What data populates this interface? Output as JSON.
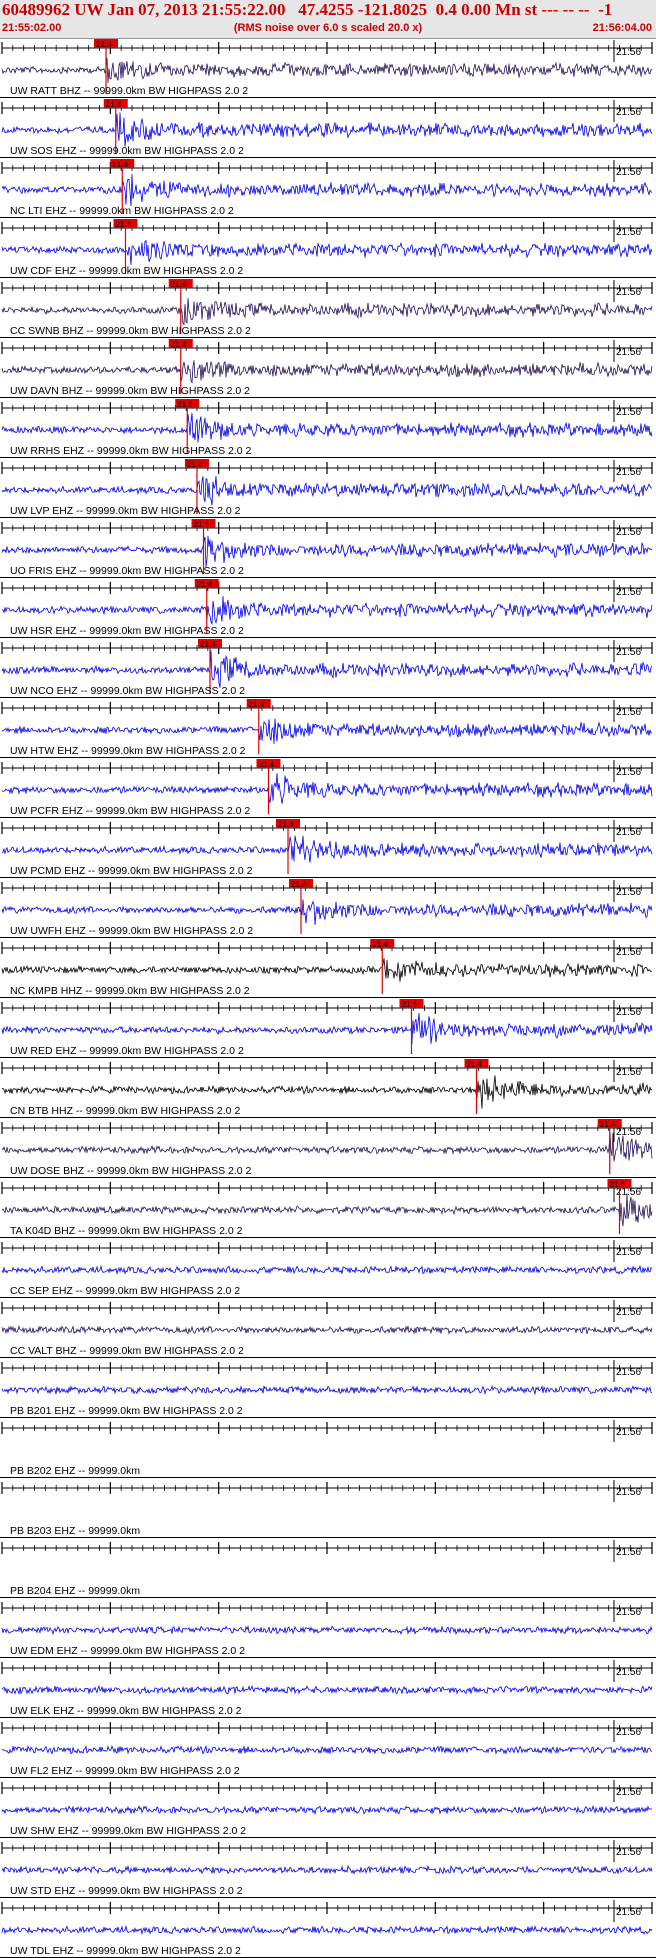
{
  "header": {
    "title": "60489962 UW Jan 07, 2013 21:55:22.00   47.4255 -121.8025  0.4 0.00 Mn st --- -- --  -1",
    "start_time": "21:55:02.00",
    "subtitle": "(RMS noise over 6.0 s scaled 20.0 x)",
    "end_time": "21:56:04.00"
  },
  "colors": {
    "background": "#ffffff",
    "title_red": "#cc0000",
    "pick_red": "#e00000",
    "trace_blue": "#0000ee",
    "trace_navy": "#26125a",
    "trace_black": "#000000",
    "axis": "#000000"
  },
  "minute_label": "21:56",
  "pick_label": "21.4",
  "traces": [
    {
      "label": "UW RATT BHZ -- 99999.0km BW  HIGHPASS  2.0  2",
      "color": "#26125a",
      "pick": 0.16
    },
    {
      "label": "UW SOS EHZ -- 99999.0km BW  HIGHPASS  2.0  2",
      "color": "#0000ee",
      "pick": 0.175
    },
    {
      "label": "NC LTI EHZ -- 99999.0km BW  HIGHPASS  2.0  2",
      "color": "#0000ee",
      "pick": 0.185
    },
    {
      "label": "UW CDF EHZ -- 99999.0km BW  HIGHPASS  2.0  2",
      "color": "#0000ee",
      "pick": 0.19
    },
    {
      "label": "CC SWNB BHZ -- 99999.0km BW  HIGHPASS  2.0  2",
      "color": "#26125a",
      "pick": 0.275
    },
    {
      "label": "UW DAVN BHZ -- 99999.0km BW  HIGHPASS  2.0  2",
      "color": "#26125a",
      "pick": 0.275
    },
    {
      "label": "UW RRHS EHZ -- 99999.0km BW  HIGHPASS  2.0  2",
      "color": "#0000ee",
      "pick": 0.285
    },
    {
      "label": "UW LVP EHZ -- 99999.0km BW  HIGHPASS  2.0  2",
      "color": "#0000ee",
      "pick": 0.3
    },
    {
      "label": "UO FRIS EHZ -- 99999.0km BW  HIGHPASS  2.0  2",
      "color": "#0000ee",
      "pick": 0.31
    },
    {
      "label": "UW HSR EHZ -- 99999.0km BW  HIGHPASS  2.0  2",
      "color": "#0000ee",
      "pick": 0.315
    },
    {
      "label": "UW NCO EHZ -- 99999.0km BW  HIGHPASS  2.0  2",
      "color": "#0000ee",
      "pick": 0.32
    },
    {
      "label": "UW HTW EHZ -- 99999.0km BW  HIGHPASS  2.0  2",
      "color": "#0000ee",
      "pick": 0.395
    },
    {
      "label": "UW PCFR EHZ -- 99999.0km BW  HIGHPASS  2.0  2",
      "color": "#0000ee",
      "pick": 0.41
    },
    {
      "label": "UW PCMD EHZ -- 99999.0km BW  HIGHPASS  2.0  2",
      "color": "#0000ee",
      "pick": 0.44
    },
    {
      "label": "UW UWFH EHZ -- 99999.0km BW  HIGHPASS  2.0  2",
      "color": "#0000ee",
      "pick": 0.46
    },
    {
      "label": "NC KMPB HHZ -- 99999.0km BW  HIGHPASS  2.0  2",
      "color": "#000000",
      "pick": 0.585
    },
    {
      "label": "UW RED EHZ -- 99999.0km BW  HIGHPASS  2.0  2",
      "color": "#0000ee",
      "pick": 0.63
    },
    {
      "label": "CN BTB HHZ -- 99999.0km BW  HIGHPASS  2.0  2",
      "color": "#000000",
      "pick": 0.73
    },
    {
      "label": "UW DOSE BHZ -- 99999.0km BW  HIGHPASS  2.0  2",
      "color": "#26125a",
      "pick": 0.935
    },
    {
      "label": "TA K04D BHZ -- 99999.0km BW  HIGHPASS  2.0  2",
      "color": "#26125a",
      "pick": 0.95
    },
    {
      "label": "CC SEP EHZ -- 99999.0km BW  HIGHPASS  2.0  2",
      "color": "#0000ee",
      "pick": null
    },
    {
      "label": "CC VALT BHZ -- 99999.0km BW  HIGHPASS  2.0  2",
      "color": "#26125a",
      "pick": null
    },
    {
      "label": "PB B201 EHZ -- 99999.0km BW  HIGHPASS  2.0  2",
      "color": "#0000ee",
      "pick": null
    },
    {
      "label": "PB B202 EHZ -- 99999.0km",
      "color": "#0000ee",
      "pick": null,
      "empty": true
    },
    {
      "label": "PB B203 EHZ -- 99999.0km",
      "color": "#0000ee",
      "pick": null,
      "empty": true
    },
    {
      "label": "PB B204 EHZ -- 99999.0km",
      "color": "#0000ee",
      "pick": null,
      "empty": true
    },
    {
      "label": "UW EDM EHZ -- 99999.0km BW  HIGHPASS  2.0  2",
      "color": "#0000ee",
      "pick": null
    },
    {
      "label": "UW ELK EHZ -- 99999.0km BW  HIGHPASS  2.0  2",
      "color": "#0000ee",
      "pick": null
    },
    {
      "label": "UW FL2 EHZ -- 99999.0km BW  HIGHPASS  2.0  2",
      "color": "#0000ee",
      "pick": null
    },
    {
      "label": "UW SHW EHZ -- 99999.0km BW  HIGHPASS  2.0  2",
      "color": "#0000ee",
      "pick": null
    },
    {
      "label": "UW STD EHZ -- 99999.0km BW  HIGHPASS  2.0  2",
      "color": "#0000ee",
      "pick": null
    },
    {
      "label": "UW TDL EHZ -- 99999.0km BW  HIGHPASS  2.0  2",
      "color": "#0000ee",
      "pick": null
    }
  ]
}
